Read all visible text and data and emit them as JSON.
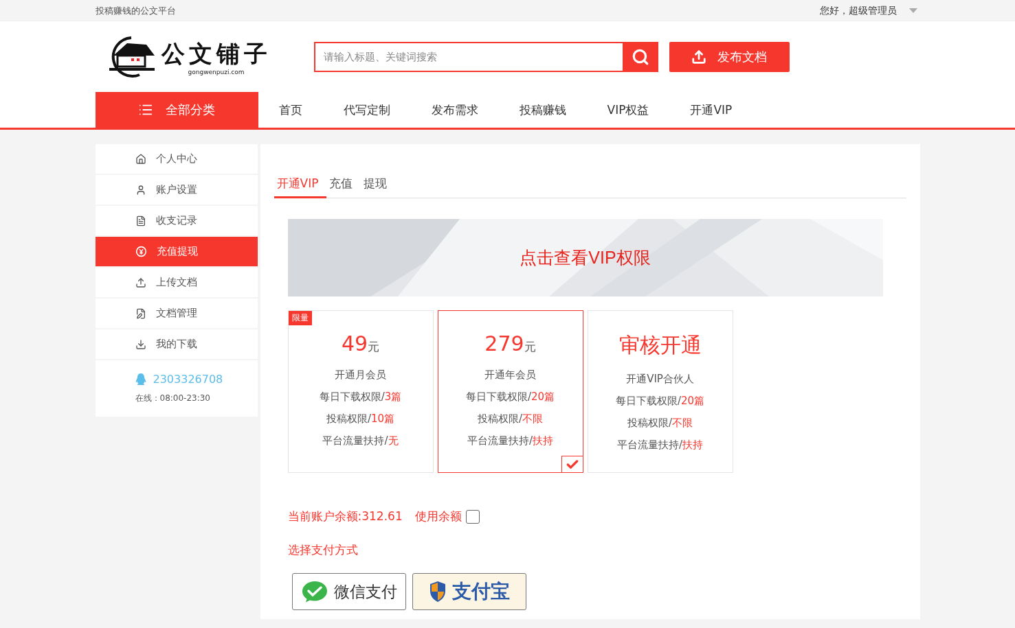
{
  "top_bar": {
    "slogan": "投稿赚钱的公文平台",
    "greeting": "您好，超级管理员"
  },
  "header": {
    "logo_text": "公文铺子",
    "logo_domain": "gongwenpuzi.com",
    "search": {
      "placeholder": "请输入标题、关键词搜索"
    },
    "publish_button": "发布文档"
  },
  "nav": {
    "all_categories": "全部分类",
    "items": [
      {
        "label": "首页",
        "selected": false
      },
      {
        "label": "代写定制",
        "selected": false
      },
      {
        "label": "发布需求",
        "selected": false
      },
      {
        "label": "投稿赚钱",
        "selected": false
      },
      {
        "label": "VIP权益",
        "selected": false
      },
      {
        "label": "开通VIP",
        "selected": false
      }
    ]
  },
  "sidebar": {
    "items": [
      {
        "label": "个人中心",
        "kind": "home",
        "selected": false
      },
      {
        "label": "账户设置",
        "kind": "user",
        "selected": false
      },
      {
        "label": "收支记录",
        "kind": "record",
        "selected": false
      },
      {
        "label": "充值提现",
        "kind": "yuan",
        "selected": true
      },
      {
        "label": "上传文档",
        "kind": "upload",
        "selected": false
      },
      {
        "label": "文档管理",
        "kind": "docs",
        "selected": false
      },
      {
        "label": "我的下载",
        "kind": "download",
        "selected": false
      }
    ],
    "contact": {
      "qq": "2303326708",
      "hours": "在线：08:00-23:30"
    }
  },
  "tabs": [
    {
      "label": "开通VIP",
      "selected": true
    },
    {
      "label": "充值",
      "selected": false
    },
    {
      "label": "提现",
      "selected": false
    }
  ],
  "banner": {
    "text": "点击查看VIP权限"
  },
  "plans": [
    {
      "badge": "限量",
      "price": "49",
      "unit": "元",
      "selected": false,
      "lines": [
        {
          "label": "开通月会员"
        },
        {
          "label": "每日下载权限/",
          "value": "3篇"
        },
        {
          "label": "投稿权限/",
          "value": "10篇"
        },
        {
          "label": "平台流量扶持/",
          "value": "无"
        }
      ]
    },
    {
      "price": "279",
      "unit": "元",
      "selected": true,
      "lines": [
        {
          "label": "开通年会员"
        },
        {
          "label": "每日下载权限/",
          "value": "20篇"
        },
        {
          "label": "投稿权限/",
          "value": "不限"
        },
        {
          "label": "平台流量扶持/",
          "value": "扶持"
        }
      ]
    },
    {
      "price": "审核开通",
      "selected": false,
      "lines": [
        {
          "label": "开通VIP合伙人"
        },
        {
          "label": "每日下载权限/",
          "value": "20篇"
        },
        {
          "label": "投稿权限/",
          "value": "不限"
        },
        {
          "label": "平台流量扶持/",
          "value": "扶持"
        }
      ]
    }
  ],
  "balance": {
    "text": "当前账户余额:312.61",
    "use_label": "使用余额",
    "checked": false
  },
  "payment": {
    "title": "选择支付方式",
    "methods": [
      {
        "kind": "wechat",
        "label": "微信支付"
      },
      {
        "kind": "alipay",
        "label": "支付宝"
      }
    ]
  }
}
